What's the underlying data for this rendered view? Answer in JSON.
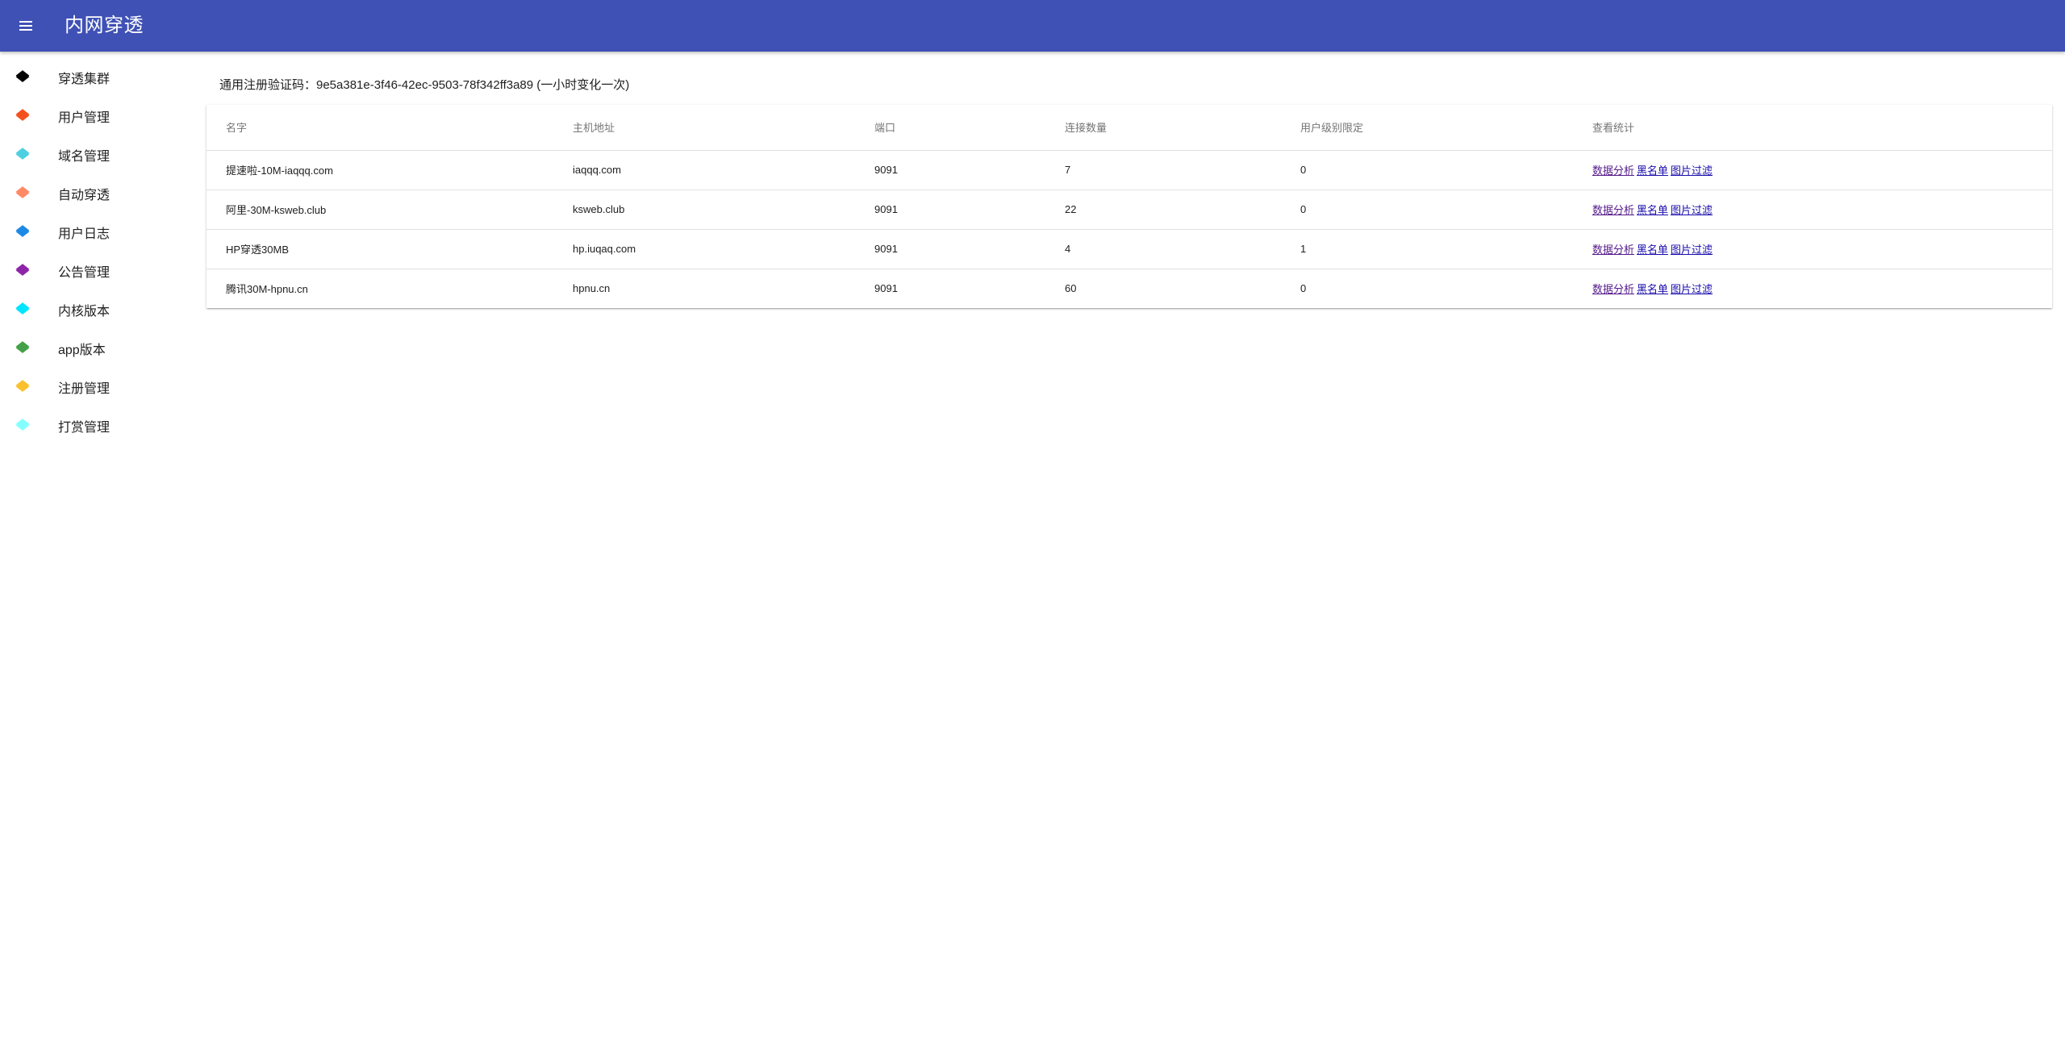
{
  "header": {
    "title": "内网穿透",
    "menu_icon": "menu-icon",
    "background": "#3f51b5"
  },
  "sidebar": {
    "items": [
      {
        "label": "穿透集群",
        "icon": "layers-icon",
        "color": "#000000"
      },
      {
        "label": "用户管理",
        "icon": "layers-icon",
        "color": "#f4511e"
      },
      {
        "label": "域名管理",
        "icon": "layers-icon",
        "color": "#4dd0e1"
      },
      {
        "label": "自动穿透",
        "icon": "layers-icon",
        "color": "#ff8a65"
      },
      {
        "label": "用户日志",
        "icon": "layers-icon",
        "color": "#1e88e5"
      },
      {
        "label": "公告管理",
        "icon": "layers-icon",
        "color": "#8e24aa"
      },
      {
        "label": "内核版本",
        "icon": "layers-icon",
        "color": "#00e5ff"
      },
      {
        "label": "app版本",
        "icon": "layers-icon",
        "color": "#43a047"
      },
      {
        "label": "注册管理",
        "icon": "layers-icon",
        "color": "#fbc02d"
      },
      {
        "label": "打赏管理",
        "icon": "layers-icon",
        "color": "#84ffff"
      }
    ]
  },
  "main": {
    "reg_code": "通用注册验证码：9e5a381e-3f46-42ec-9503-78f342ff3a89 (一小时变化一次)",
    "table": {
      "headers": [
        "名字",
        "主机地址",
        "端口",
        "连接数量",
        "用户级别限定",
        "查看统计"
      ],
      "rows": [
        {
          "name": "提速啦-10M-iaqqq.com",
          "host": "iaqqq.com",
          "port": "9091",
          "connections": "7",
          "level": "0"
        },
        {
          "name": "阿里-30M-ksweb.club",
          "host": "ksweb.club",
          "port": "9091",
          "connections": "22",
          "level": "0"
        },
        {
          "name": "HP穿透30MB",
          "host": "hp.iuqaq.com",
          "port": "9091",
          "connections": "4",
          "level": "1"
        },
        {
          "name": "腾讯30M-hpnu.cn",
          "host": "hpnu.cn",
          "port": "9091",
          "connections": "60",
          "level": "0"
        }
      ],
      "links": {
        "analysis": "数据分析",
        "blacklist": "黑名单",
        "image_filter": "图片过滤"
      }
    }
  }
}
